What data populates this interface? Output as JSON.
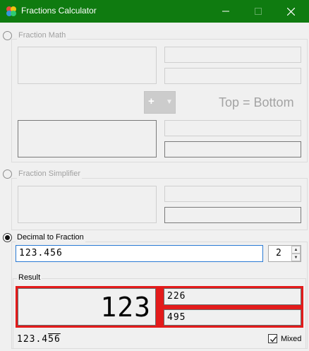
{
  "window": {
    "title": "Fractions Calculator",
    "title_bar_color": "#0f7b10",
    "controls": {
      "minimize": "minimize-icon",
      "maximize": "maximize-icon",
      "close": "close-icon"
    }
  },
  "fraction_math": {
    "label": "Fraction Math",
    "selected": false,
    "enabled": false,
    "operator": "+",
    "top_bottom_label": "Top = Bottom"
  },
  "fraction_simplifier": {
    "label": "Fraction Simplifier",
    "selected": false,
    "enabled": false
  },
  "decimal_to_fraction": {
    "label": "Decimal to Fraction",
    "selected": true,
    "input_value": "123.456",
    "repeat_digits": "2"
  },
  "result": {
    "label": "Result",
    "whole": "123",
    "numerator": "226",
    "denominator": "495",
    "accent_color": "#e31b1b",
    "decimal_display_prefix": "123.4",
    "decimal_display_repeat": "56",
    "mixed_label": "Mixed",
    "mixed_checked": true
  }
}
